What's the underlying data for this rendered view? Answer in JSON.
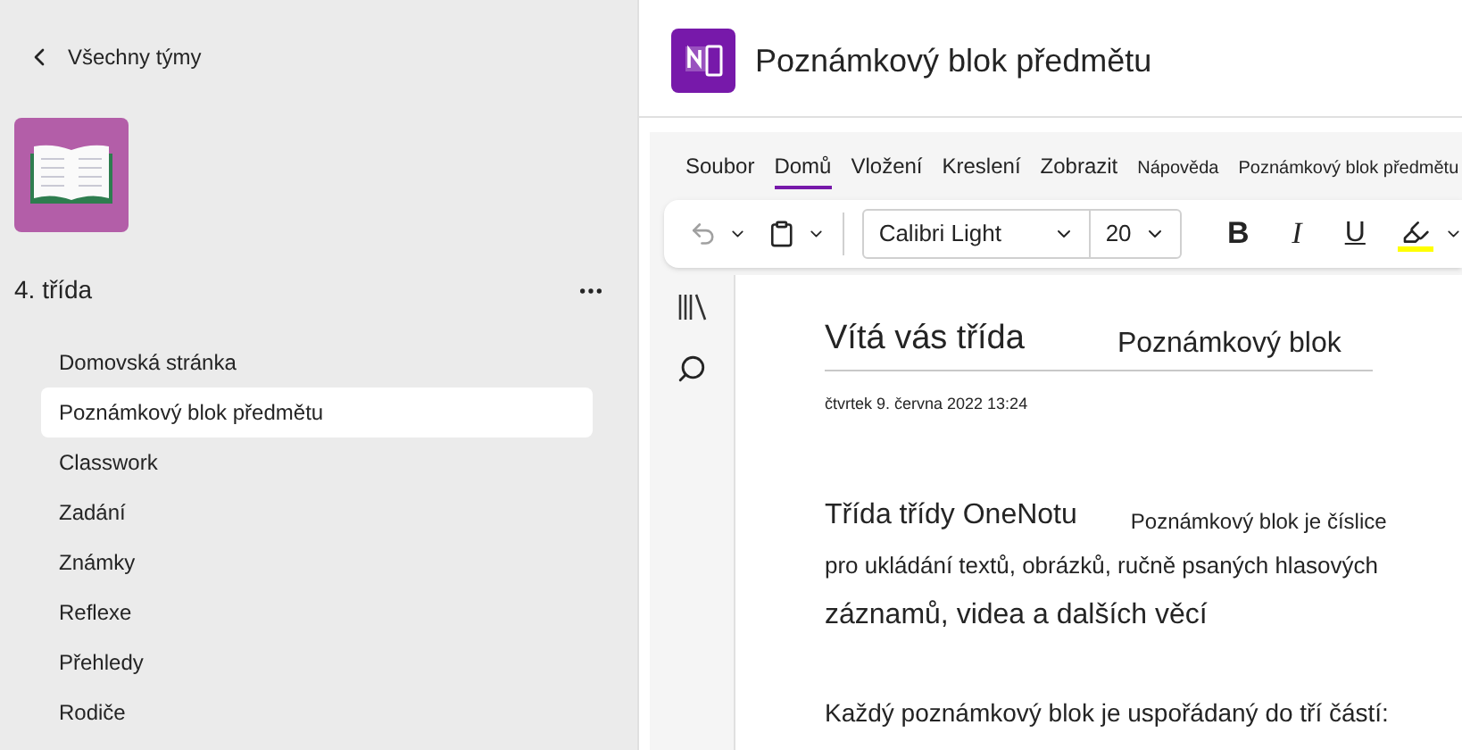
{
  "sidebar": {
    "back_label": "Všechny týmy",
    "team_name": "4. třída",
    "items": [
      {
        "label": "Domovská stránka",
        "selected": false
      },
      {
        "label": "Poznámkový blok předmětu",
        "selected": true
      },
      {
        "label": "Classwork",
        "selected": false
      },
      {
        "label": "Zadání",
        "selected": false
      },
      {
        "label": "Známky",
        "selected": false
      },
      {
        "label": "Reflexe",
        "selected": false
      },
      {
        "label": "Přehledy",
        "selected": false
      },
      {
        "label": "Rodiče",
        "selected": false
      }
    ]
  },
  "header": {
    "title": "Poznámkový blok předmětu"
  },
  "ribbon_tabs": [
    {
      "label": "Soubor",
      "selected": false
    },
    {
      "label": "Domů",
      "selected": true
    },
    {
      "label": "Vložení",
      "selected": false
    },
    {
      "label": "Kreslení",
      "selected": false
    },
    {
      "label": "Zobrazit",
      "selected": false
    },
    {
      "label": "Nápověda",
      "selected": false
    },
    {
      "label": "Poznámkový blok předmětu",
      "selected": false
    }
  ],
  "toolbar": {
    "font": "Calibri Light",
    "size": "20",
    "bold": "B",
    "italic": "I",
    "underline": "U"
  },
  "page": {
    "title": "Vítá vás třída",
    "title_2": "Poznámkový blok",
    "date": "čtvrtek 9. června 2022 13:24",
    "para_1a": "Třída třídy OneNotu",
    "para_1b": "Poznámkový blok je číslice",
    "para_2": "pro ukládání textů, obrázků, ručně psaných hlasových",
    "para_3": "záznamů, videa a dalších věcí",
    "para_4": "Každý poznámkový blok je uspořádaný do tří částí:"
  }
}
